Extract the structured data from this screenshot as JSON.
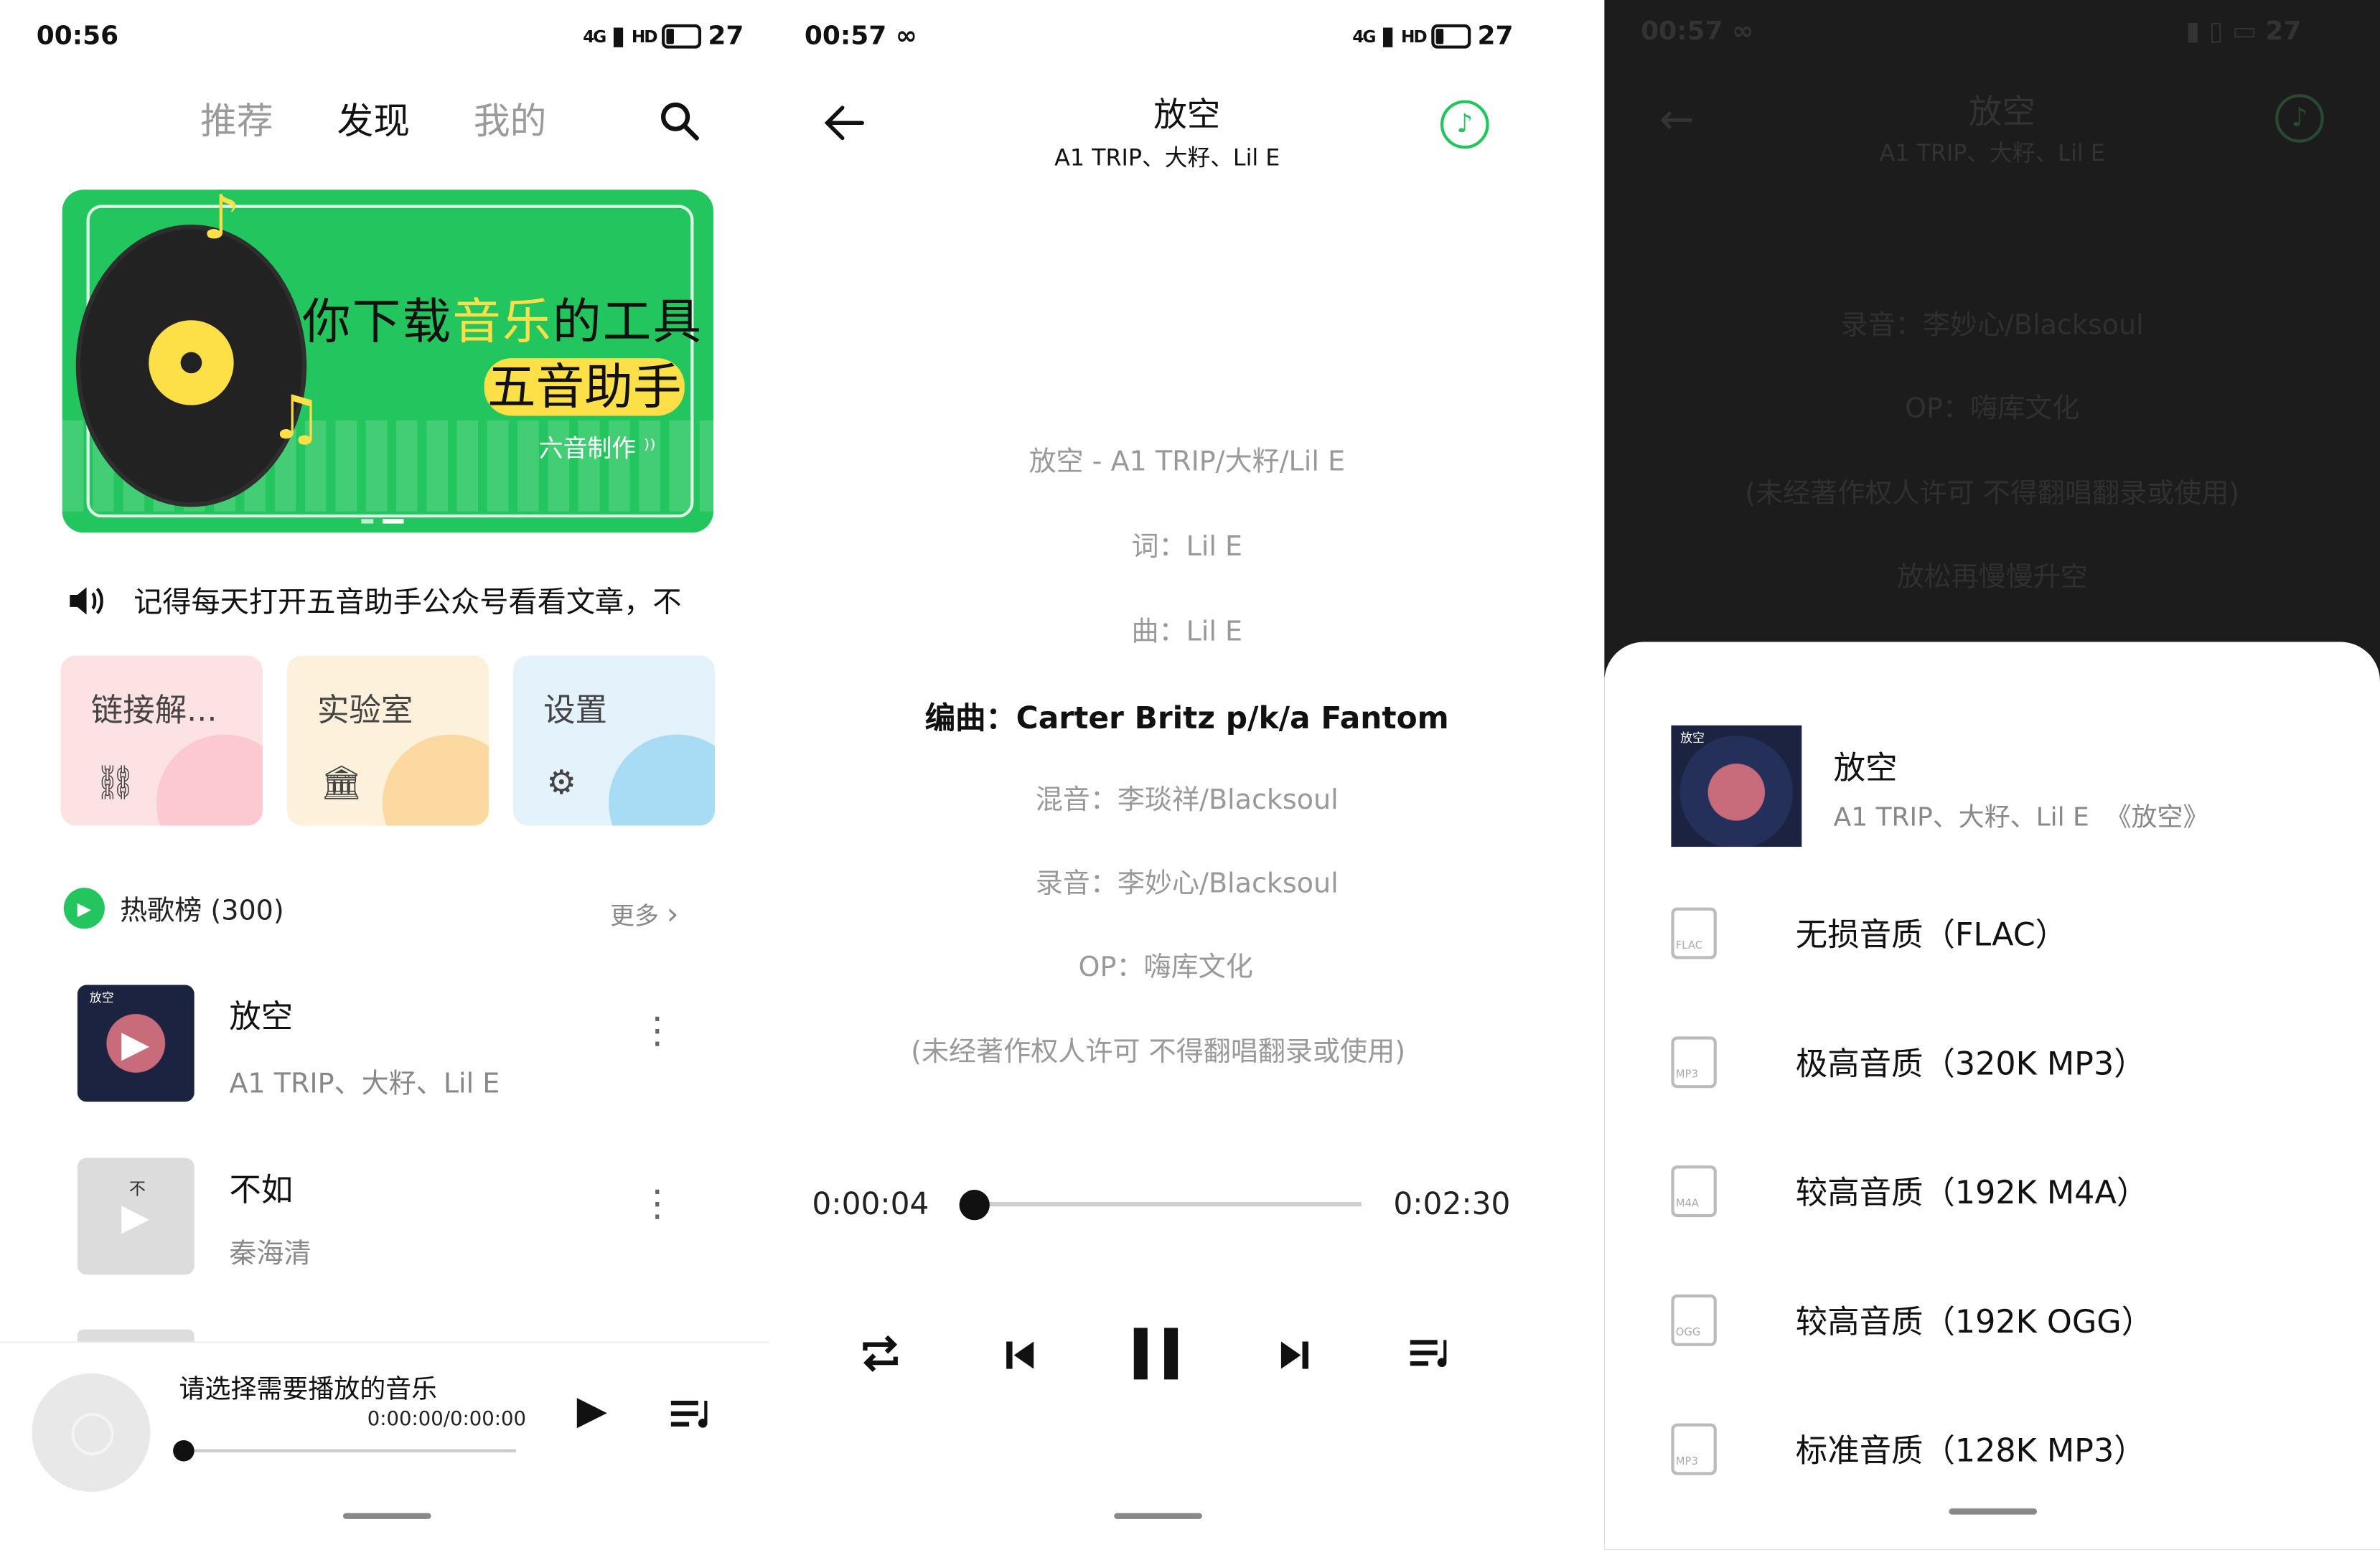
{
  "screen1": {
    "status": {
      "time": "00:56",
      "battery": "27",
      "signal": "4G",
      "hd": "HD"
    },
    "tabs": [
      "推荐",
      "发现",
      "我的"
    ],
    "banner": {
      "line1_pre": "你下载",
      "line1_hl": "音乐",
      "line1_post": "的工具",
      "line2": "五音助手",
      "line3": "六音制作"
    },
    "notice": "记得每天打开五音助手公众号看看文章，不",
    "cards": [
      {
        "label": "链接解..."
      },
      {
        "label": "实验室"
      },
      {
        "label": "设置"
      }
    ],
    "hot": {
      "title": "热歌榜 (300)",
      "more": "更多"
    },
    "songs": [
      {
        "title": "放空",
        "artist": "A1 TRIP、大籽、Lil E",
        "cover_text": "放空"
      },
      {
        "title": "不如",
        "artist": "秦海清",
        "cover_text": "不"
      }
    ],
    "mini_player": {
      "prompt": "请选择需要播放的音乐",
      "time": "0:00:00/0:00:00",
      "progress": 0
    }
  },
  "screen2": {
    "status": {
      "time": "00:57",
      "battery": "27",
      "signal": "4G",
      "hd": "HD"
    },
    "title": "放空",
    "artist": "A1 TRIP、大籽、Lil E",
    "lyrics": [
      "放空 - A1 TRIP/大籽/Lil E",
      "词：Lil E",
      "曲：Lil E",
      "编曲：Carter Britz p/k/a Fantom",
      "混音：李琰祥/Blacksoul",
      "录音：李妙心/Blacksoul",
      "OP：嗨库文化",
      "(未经著作权人许可 不得翻唱翻录或使用)"
    ],
    "current_lyric_index": 3,
    "elapsed": "0:00:04",
    "duration": "0:02:30",
    "progress": 0.027
  },
  "screen3": {
    "status": {
      "time": "00:57",
      "battery": "27"
    },
    "title": "放空",
    "artist": "A1 TRIP、大籽、Lil E",
    "bg_lyrics": [
      "录音：李妙心/Blacksoul",
      "OP：嗨库文化",
      "(未经著作权人许可 不得翻唱翻录或使用)",
      "放松再慢慢升空"
    ],
    "sheet": {
      "song_title": "放空",
      "song_meta": "A1 TRIP、大籽、Lil E  《放空》",
      "cover_text": "放空",
      "qualities": [
        {
          "label": "无损音质（FLAC）",
          "tag": "FLAC"
        },
        {
          "label": "极高音质（320K MP3）",
          "tag": "MP3"
        },
        {
          "label": "较高音质（192K M4A）",
          "tag": "M4A"
        },
        {
          "label": "较高音质（192K OGG）",
          "tag": "OGG"
        },
        {
          "label": "标准音质（128K MP3）",
          "tag": "MP3"
        }
      ]
    }
  },
  "colors": {
    "accent": "#22c55e",
    "banner_yellow": "#fde047"
  }
}
